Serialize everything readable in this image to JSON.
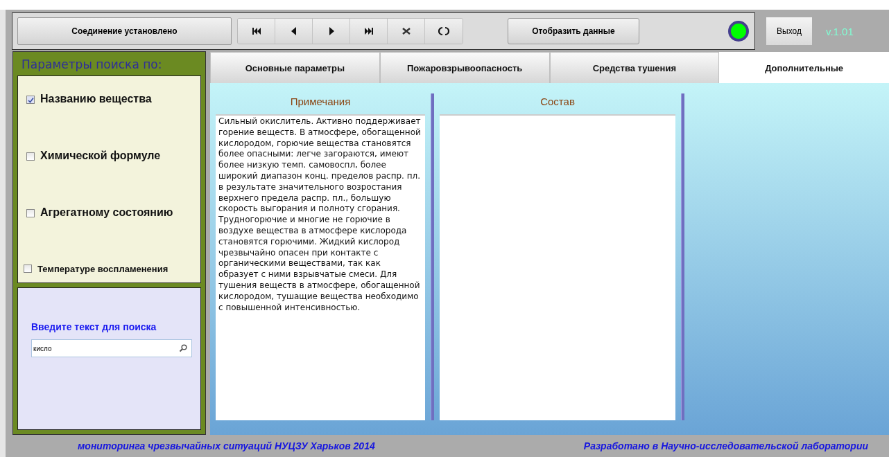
{
  "toolbar": {
    "connection_status": "Соединение установлено",
    "nav_buttons": [
      {
        "kind": "first"
      },
      {
        "kind": "prev"
      },
      {
        "kind": "next"
      },
      {
        "kind": "last"
      },
      {
        "kind": "cancel"
      },
      {
        "kind": "refresh"
      }
    ],
    "show_button": "Отобразить данные",
    "indicator": {
      "on": true
    }
  },
  "exit_button": "Выход",
  "version": "v.1.01",
  "sidebar": {
    "title": "Параметры поиска по:",
    "filters": [
      {
        "label": "Названию вещества",
        "checked": true,
        "kind": "main"
      },
      {
        "label": "Химической формуле",
        "checked": false,
        "kind": "main"
      },
      {
        "label": "Агрегатному состоянию",
        "checked": false,
        "kind": "main"
      },
      {
        "label": "Температуре воспламенения",
        "checked": false,
        "kind": "minor"
      }
    ],
    "search_label": "Введите текст для поиска",
    "search_value": "кисло"
  },
  "tabs": [
    {
      "label": "Основные параметры",
      "selected": false
    },
    {
      "label": "Пожаровзрывоопасность",
      "selected": false
    },
    {
      "label": "Средства тушения",
      "selected": false
    },
    {
      "label": "Дополнительные",
      "selected": true
    }
  ],
  "panels": [
    {
      "title": "Примечания",
      "text": "Сильный окислитель. Активно поддерживает горение веществ. В атмосфере, обогащенной кислородом, горючие вещества становятся более опасными: легче загораются, имеют более низкую темп. самовоспл, более широкий диапазон конц. пределов распр. пл. в результате значительного возростания верхнего предела распр. пл., большую скорость выгорания и полноту сгорания. Трудногорючие и многие не горючие в воздухе вещества в атмосфере кислорода становятся горючими. Жидкий кислород чрезвычайно опасен при контакте с органическими веществами, так как образует с ними взрывчатые смеси. Для тушения веществ в атмосфере, обогащенной кислородом, тушащие вещества необходимо с повышенной интенсивностью."
    },
    {
      "title": "Состав"
    }
  ],
  "footer": {
    "left": "мониторинга чрезвычайных ситуаций НУЦЗУ  Харьков 2014",
    "right": "Разработано в Научно-исследовательской лаборатории"
  }
}
